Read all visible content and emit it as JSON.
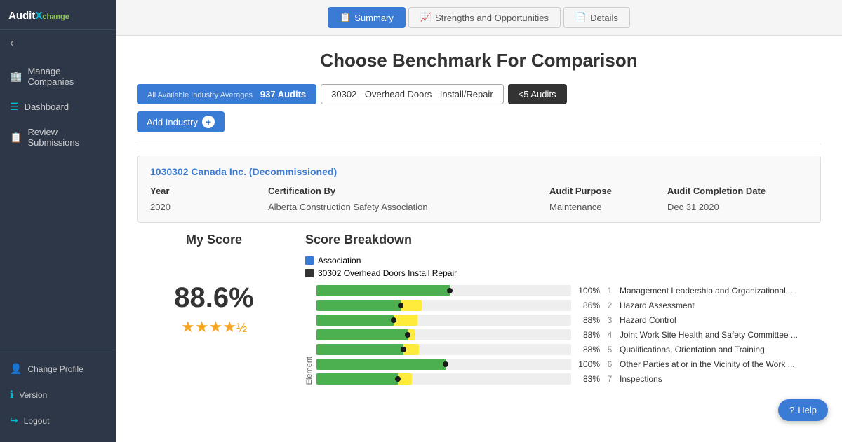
{
  "sidebar": {
    "logo": "Audit Xchange",
    "back_icon": "‹",
    "nav_items": [
      {
        "id": "manage-companies",
        "label": "Manage Companies",
        "icon": "🏢"
      },
      {
        "id": "dashboard",
        "label": "Dashboard",
        "icon": "📊"
      },
      {
        "id": "review-submissions",
        "label": "Review Submissions",
        "icon": "📋"
      }
    ],
    "bottom_items": [
      {
        "id": "change-profile",
        "label": "Change Profile",
        "icon": "👤"
      },
      {
        "id": "version",
        "label": "Version",
        "icon": "ℹ"
      },
      {
        "id": "logout",
        "label": "Logout",
        "icon": "→"
      }
    ]
  },
  "tabs": [
    {
      "id": "summary",
      "label": "Summary",
      "icon": "📋",
      "active": true
    },
    {
      "id": "strengths",
      "label": "Strengths and Opportunities",
      "icon": "📈",
      "active": false
    },
    {
      "id": "details",
      "label": "Details",
      "icon": "📄",
      "active": false
    }
  ],
  "page": {
    "title": "Choose Benchmark For Comparison",
    "benchmarks": [
      {
        "id": "all-industry",
        "label": "All Available Industry Averages",
        "count": "937 Audits",
        "style": "blue-active"
      },
      {
        "id": "overhead-doors",
        "label": "30302 - Overhead Doors - Install/Repair",
        "style": "outline"
      },
      {
        "id": "less5",
        "label": "<5 Audits",
        "style": "dark"
      }
    ],
    "add_industry_label": "Add Industry",
    "audit_card": {
      "title": "1030302 Canada Inc. (Decommissioned)",
      "year_header": "Year",
      "year_value": "2020",
      "cert_header": "Certification By",
      "cert_value": "Alberta Construction Safety Association",
      "purpose_header": "Audit Purpose",
      "purpose_value": "Maintenance",
      "completion_header": "Audit Completion Date",
      "completion_value": "Dec 31 2020"
    },
    "my_score": {
      "title": "My Score",
      "value": "88.6%",
      "stars": "★★★★½"
    },
    "score_breakdown": {
      "title": "Score Breakdown",
      "legend": [
        {
          "color": "#3a7bd5",
          "label": "Association"
        },
        {
          "color": "#333",
          "label": "30302 Overhead Doors Install Repair"
        }
      ],
      "y_axis_label": "Element",
      "bars": [
        {
          "pct": "100%",
          "num": "1",
          "label": "Management Leadership and Organizational ...",
          "green_w": 95,
          "yellow_w": 0
        },
        {
          "pct": "86%",
          "num": "2",
          "label": "Hazard Assessment",
          "green_w": 60,
          "yellow_w": 75
        },
        {
          "pct": "88%",
          "num": "3",
          "label": "Hazard Control",
          "green_w": 55,
          "yellow_w": 72
        },
        {
          "pct": "88%",
          "num": "4",
          "label": "Joint Work Site Health and Safety Committee ...",
          "green_w": 65,
          "yellow_w": 70
        },
        {
          "pct": "88%",
          "num": "5",
          "label": "Qualifications, Orientation and Training",
          "green_w": 62,
          "yellow_w": 73
        },
        {
          "pct": "100%",
          "num": "6",
          "label": "Other Parties at or in the Vicinity of the Work ...",
          "green_w": 92,
          "yellow_w": 0
        },
        {
          "pct": "83%",
          "num": "7",
          "label": "Inspections",
          "green_w": 58,
          "yellow_w": 68
        }
      ]
    }
  },
  "help_label": "Help"
}
